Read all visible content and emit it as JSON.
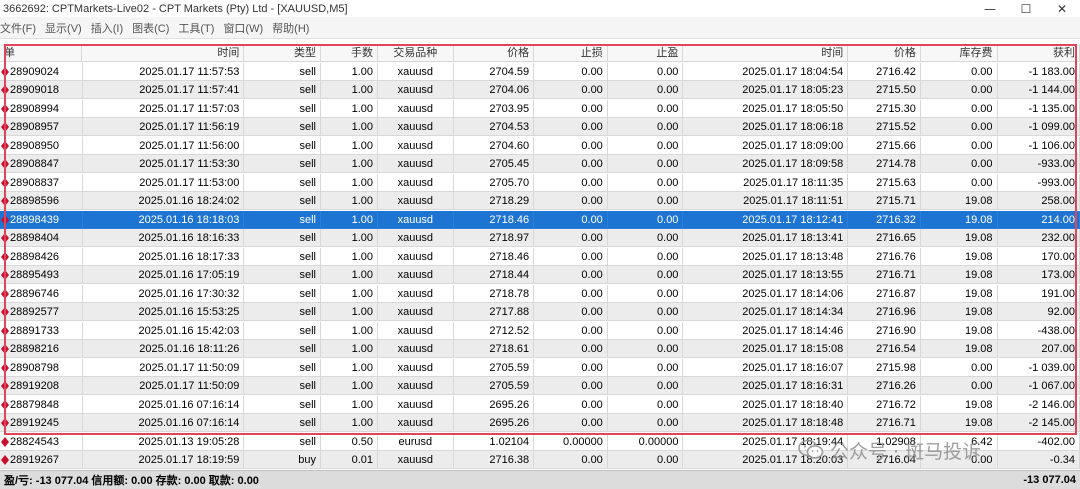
{
  "window": {
    "title": "3662692: CPTMarkets-Live02 - CPT Markets (Pty) Ltd - [XAUUSD,M5]",
    "minimize": "—",
    "maximize": "☐",
    "close": "✕"
  },
  "menu": [
    "文件(F)",
    "显示(V)",
    "插入(I)",
    "图表(C)",
    "工具(T)",
    "窗口(W)",
    "帮助(H)"
  ],
  "columns": [
    "单",
    "时间",
    "类型",
    "手数",
    "交易品种",
    "价格",
    "止损",
    "止盈",
    "时间",
    "价格",
    "库存费",
    "获利"
  ],
  "rows": [
    [
      "28909024",
      "2025.01.17 11:57:53",
      "sell",
      "1.00",
      "xauusd",
      "2704.59",
      "0.00",
      "0.00",
      "2025.01.17 18:04:54",
      "2716.42",
      "0.00",
      "-1 183.00"
    ],
    [
      "28909018",
      "2025.01.17 11:57:41",
      "sell",
      "1.00",
      "xauusd",
      "2704.06",
      "0.00",
      "0.00",
      "2025.01.17 18:05:23",
      "2715.50",
      "0.00",
      "-1 144.00"
    ],
    [
      "28908994",
      "2025.01.17 11:57:03",
      "sell",
      "1.00",
      "xauusd",
      "2703.95",
      "0.00",
      "0.00",
      "2025.01.17 18:05:50",
      "2715.30",
      "0.00",
      "-1 135.00"
    ],
    [
      "28908957",
      "2025.01.17 11:56:19",
      "sell",
      "1.00",
      "xauusd",
      "2704.53",
      "0.00",
      "0.00",
      "2025.01.17 18:06:18",
      "2715.52",
      "0.00",
      "-1 099.00"
    ],
    [
      "28908950",
      "2025.01.17 11:56:00",
      "sell",
      "1.00",
      "xauusd",
      "2704.60",
      "0.00",
      "0.00",
      "2025.01.17 18:09:00",
      "2715.66",
      "0.00",
      "-1 106.00"
    ],
    [
      "28908847",
      "2025.01.17 11:53:30",
      "sell",
      "1.00",
      "xauusd",
      "2705.45",
      "0.00",
      "0.00",
      "2025.01.17 18:09:58",
      "2714.78",
      "0.00",
      "-933.00"
    ],
    [
      "28908837",
      "2025.01.17 11:53:00",
      "sell",
      "1.00",
      "xauusd",
      "2705.70",
      "0.00",
      "0.00",
      "2025.01.17 18:11:35",
      "2715.63",
      "0.00",
      "-993.00"
    ],
    [
      "28898596",
      "2025.01.16 18:24:02",
      "sell",
      "1.00",
      "xauusd",
      "2718.29",
      "0.00",
      "0.00",
      "2025.01.17 18:11:51",
      "2715.71",
      "19.08",
      "258.00"
    ],
    [
      "28898439",
      "2025.01.16 18:18:03",
      "sell",
      "1.00",
      "xauusd",
      "2718.46",
      "0.00",
      "0.00",
      "2025.01.17 18:12:41",
      "2716.32",
      "19.08",
      "214.00"
    ],
    [
      "28898404",
      "2025.01.16 18:16:33",
      "sell",
      "1.00",
      "xauusd",
      "2718.97",
      "0.00",
      "0.00",
      "2025.01.17 18:13:41",
      "2716.65",
      "19.08",
      "232.00"
    ],
    [
      "28898426",
      "2025.01.16 18:17:33",
      "sell",
      "1.00",
      "xauusd",
      "2718.46",
      "0.00",
      "0.00",
      "2025.01.17 18:13:48",
      "2716.76",
      "19.08",
      "170.00"
    ],
    [
      "28895493",
      "2025.01.16 17:05:19",
      "sell",
      "1.00",
      "xauusd",
      "2718.44",
      "0.00",
      "0.00",
      "2025.01.17 18:13:55",
      "2716.71",
      "19.08",
      "173.00"
    ],
    [
      "28896746",
      "2025.01.16 17:30:32",
      "sell",
      "1.00",
      "xauusd",
      "2718.78",
      "0.00",
      "0.00",
      "2025.01.17 18:14:06",
      "2716.87",
      "19.08",
      "191.00"
    ],
    [
      "28892577",
      "2025.01.16 15:53:25",
      "sell",
      "1.00",
      "xauusd",
      "2717.88",
      "0.00",
      "0.00",
      "2025.01.17 18:14:34",
      "2716.96",
      "19.08",
      "92.00"
    ],
    [
      "28891733",
      "2025.01.16 15:42:03",
      "sell",
      "1.00",
      "xauusd",
      "2712.52",
      "0.00",
      "0.00",
      "2025.01.17 18:14:46",
      "2716.90",
      "19.08",
      "-438.00"
    ],
    [
      "28898216",
      "2025.01.16 18:11:26",
      "sell",
      "1.00",
      "xauusd",
      "2718.61",
      "0.00",
      "0.00",
      "2025.01.17 18:15:08",
      "2716.54",
      "19.08",
      "207.00"
    ],
    [
      "28908798",
      "2025.01.17 11:50:09",
      "sell",
      "1.00",
      "xauusd",
      "2705.59",
      "0.00",
      "0.00",
      "2025.01.17 18:16:07",
      "2715.98",
      "0.00",
      "-1 039.00"
    ],
    [
      "28919208",
      "2025.01.17 11:50:09",
      "sell",
      "1.00",
      "xauusd",
      "2705.59",
      "0.00",
      "0.00",
      "2025.01.17 18:16:31",
      "2716.26",
      "0.00",
      "-1 067.00"
    ],
    [
      "28879848",
      "2025.01.16 07:16:14",
      "sell",
      "1.00",
      "xauusd",
      "2695.26",
      "0.00",
      "0.00",
      "2025.01.17 18:18:40",
      "2716.72",
      "19.08",
      "-2 146.00"
    ],
    [
      "28919245",
      "2025.01.16 07:16:14",
      "sell",
      "1.00",
      "xauusd",
      "2695.26",
      "0.00",
      "0.00",
      "2025.01.17 18:18:48",
      "2716.71",
      "19.08",
      "-2 145.00"
    ],
    [
      "28824543",
      "2025.01.13 19:05:28",
      "sell",
      "0.50",
      "eurusd",
      "1.02104",
      "0.00000",
      "0.00000",
      "2025.01.17 18:19:44",
      "1.02908",
      "6.42",
      "-402.00"
    ],
    [
      "28919267",
      "2025.01.17 18:19:59",
      "buy",
      "0.01",
      "xauusd",
      "2716.38",
      "0.00",
      "0.00",
      "2025.01.17 18:20:03",
      "2716.04",
      "0.00",
      "-0.34"
    ]
  ],
  "selected_row": 8,
  "status": {
    "summary": "盈/亏: -13 077.04  信用额: 0.00  存款: 0.00  取款: 0.00",
    "total": "-13 077.04"
  },
  "watermark": {
    "text": "公众号 · 斑马投诉",
    "brand": "斑马投诉"
  },
  "colors": {
    "selected_row": "#1e74d2",
    "highlight_border": "#e0465a",
    "order_icon": "#c8102e"
  },
  "icons": {
    "order": "closed-order-icon",
    "watermark": "wechat-icon"
  }
}
